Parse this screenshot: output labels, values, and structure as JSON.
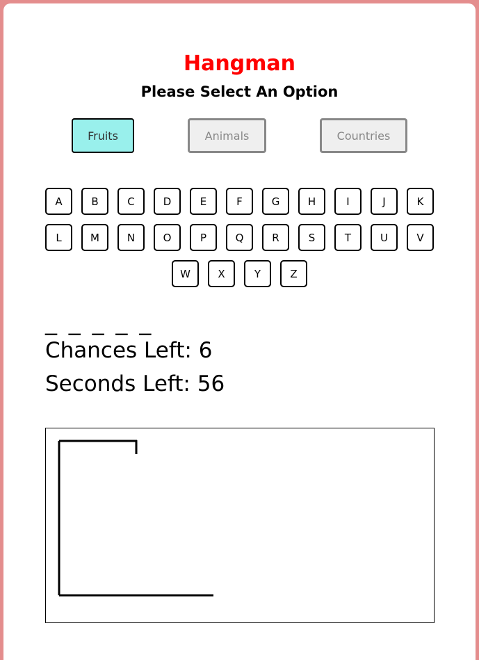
{
  "title": "Hangman",
  "subtitle": "Please Select An Option",
  "options": [
    "Fruits",
    "Animals",
    "Countries"
  ],
  "selected_option": "Fruits",
  "letters_row1": [
    "A",
    "B",
    "C",
    "D",
    "E",
    "F",
    "G",
    "H",
    "I",
    "J",
    "K"
  ],
  "letters_row2": [
    "L",
    "M",
    "N",
    "O",
    "P",
    "Q",
    "R",
    "S",
    "T",
    "U",
    "V"
  ],
  "letters_row3": [
    "W",
    "X",
    "Y",
    "Z"
  ],
  "word_display": "_ _ _ _ _",
  "chances_label": "Chances Left:",
  "chances_value": "6",
  "seconds_label": "Seconds Left:",
  "seconds_value": "56",
  "colors": {
    "background": "#e48d8d",
    "title": "#ff0000",
    "selected_option_bg": "#99f0ec"
  }
}
